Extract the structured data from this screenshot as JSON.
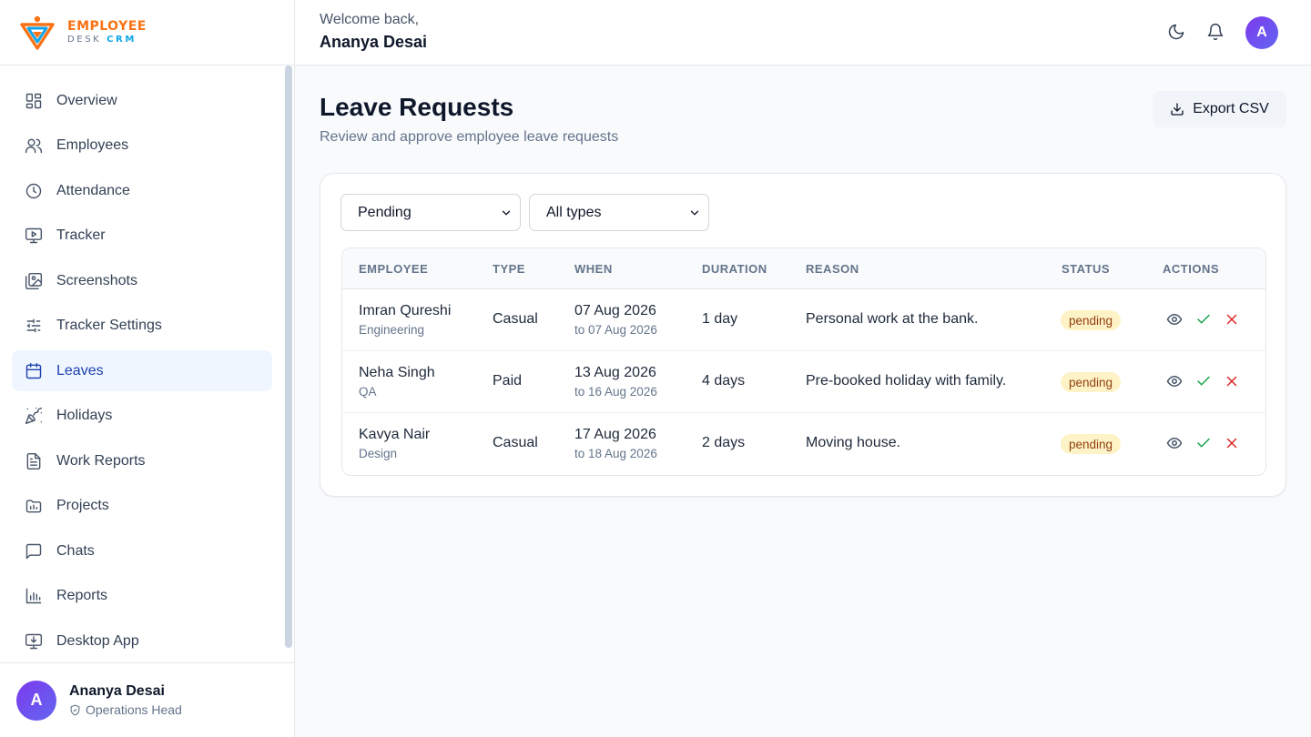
{
  "brand": {
    "line1": "EMPLOYEE",
    "line2a": "DESK ",
    "line2b": "CRM"
  },
  "colors": {
    "accent": "#1e40af",
    "brand_orange": "#f97316",
    "brand_blue": "#0ea5e9",
    "pending_bg": "#fef3c7",
    "pending_text": "#92400e",
    "approve": "#16a34a",
    "reject": "#dc2626"
  },
  "nav": [
    {
      "label": "Overview",
      "icon": "grid-icon"
    },
    {
      "label": "Employees",
      "icon": "users-icon"
    },
    {
      "label": "Attendance",
      "icon": "clock-icon"
    },
    {
      "label": "Tracker",
      "icon": "monitor-play-icon"
    },
    {
      "label": "Screenshots",
      "icon": "images-icon"
    },
    {
      "label": "Tracker Settings",
      "icon": "sliders-icon"
    },
    {
      "label": "Leaves",
      "icon": "calendar-icon",
      "active": true
    },
    {
      "label": "Holidays",
      "icon": "party-popper-icon"
    },
    {
      "label": "Work Reports",
      "icon": "file-text-icon"
    },
    {
      "label": "Projects",
      "icon": "folder-icon"
    },
    {
      "label": "Chats",
      "icon": "message-square-icon"
    },
    {
      "label": "Reports",
      "icon": "bar-chart-icon"
    },
    {
      "label": "Desktop App",
      "icon": "monitor-download-icon"
    }
  ],
  "user": {
    "initial": "A",
    "name": "Ananya Desai",
    "role": "Operations Head"
  },
  "header": {
    "welcome": "Welcome back,",
    "name": "Ananya Desai",
    "avatar_initial": "A"
  },
  "page": {
    "title": "Leave Requests",
    "subtitle": "Review and approve employee leave requests",
    "export_label": "Export CSV"
  },
  "filters": {
    "status": "Pending",
    "type": "All types"
  },
  "table": {
    "headers": [
      "EMPLOYEE",
      "TYPE",
      "WHEN",
      "DURATION",
      "REASON",
      "STATUS",
      "ACTIONS"
    ],
    "rows": [
      {
        "name": "Imran Qureshi",
        "dept": "Engineering",
        "type": "Casual",
        "from": "07 Aug 2026",
        "to": "to 07 Aug 2026",
        "duration": "1 day",
        "reason": "Personal work at the bank.",
        "status": "pending"
      },
      {
        "name": "Neha Singh",
        "dept": "QA",
        "type": "Paid",
        "from": "13 Aug 2026",
        "to": "to 16 Aug 2026",
        "duration": "4 days",
        "reason": "Pre-booked holiday with family.",
        "status": "pending"
      },
      {
        "name": "Kavya Nair",
        "dept": "Design",
        "type": "Casual",
        "from": "17 Aug 2026",
        "to": "to 18 Aug 2026",
        "duration": "2 days",
        "reason": "Moving house.",
        "status": "pending"
      }
    ]
  }
}
